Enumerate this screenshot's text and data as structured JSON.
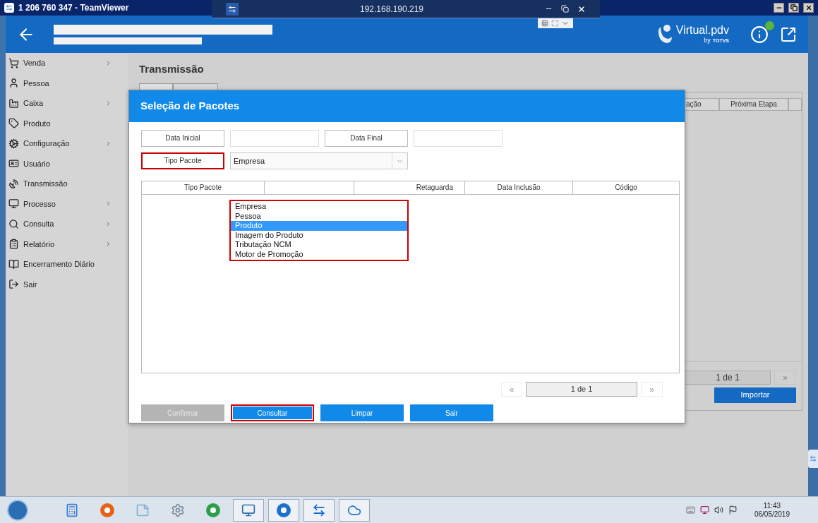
{
  "remote_title_bar": {
    "title": "1 206 760 347 - TeamViewer"
  },
  "teamviewer_panel": {
    "address": "192.168.190.219"
  },
  "header": {
    "logo": "Virtual.pdv",
    "logo_by": "by",
    "logo_brand": "TOTVS"
  },
  "sidebar": {
    "items": [
      {
        "label": "Venda",
        "submenu": true
      },
      {
        "label": "Pessoa",
        "submenu": false
      },
      {
        "label": "Caixa",
        "submenu": true
      },
      {
        "label": "Produto",
        "submenu": false
      },
      {
        "label": "Configuração",
        "submenu": true
      },
      {
        "label": "Usuário",
        "submenu": false
      },
      {
        "label": "Transmissão",
        "submenu": false
      },
      {
        "label": "Processo",
        "submenu": true
      },
      {
        "label": "Consulta",
        "submenu": true
      },
      {
        "label": "Relatório",
        "submenu": true
      },
      {
        "label": "Encerramento Diário",
        "submenu": false
      },
      {
        "label": "Sair",
        "submenu": false
      }
    ]
  },
  "page": {
    "title": "Transmissão"
  },
  "background_table": {
    "columns": [
      "ação",
      "Próxima Etapa"
    ],
    "page": "1 de 1",
    "next": "»",
    "import_button": "Importar"
  },
  "dialog": {
    "title": "Seleção de Pacotes",
    "date_start_label": "Data Inicial",
    "date_end_label": "Data Final",
    "type_label": {
      "text": "Tipo Pacote",
      "highlighted": true
    },
    "type_select": {
      "value": "Empresa",
      "expanded": true
    },
    "type_options": {
      "highlighted": true,
      "items": [
        {
          "label": "Empresa",
          "selected": false
        },
        {
          "label": "Pessoa",
          "selected": false
        },
        {
          "label": "Produto",
          "selected": true
        },
        {
          "label": "Imagem do Produto",
          "selected": false
        },
        {
          "label": "Tributação NCM",
          "selected": false
        },
        {
          "label": "Motor de Promoção",
          "selected": false
        }
      ]
    },
    "table": {
      "columns": [
        "Tipo Pacote",
        "Retaguarda",
        "Data Inclusão",
        "Código"
      ]
    },
    "pager": {
      "prev": "«",
      "page": "1 de 1",
      "next": "»"
    },
    "buttons": [
      {
        "label": "Confirmar",
        "disabled": true,
        "highlighted": false
      },
      {
        "label": "Consultar",
        "disabled": false,
        "highlighted": true
      },
      {
        "label": "Limpar",
        "disabled": false,
        "highlighted": false
      },
      {
        "label": "Sair",
        "disabled": false,
        "highlighted": false
      }
    ]
  },
  "taskbar": {
    "time": "11:43",
    "date": "06/05/2019"
  }
}
